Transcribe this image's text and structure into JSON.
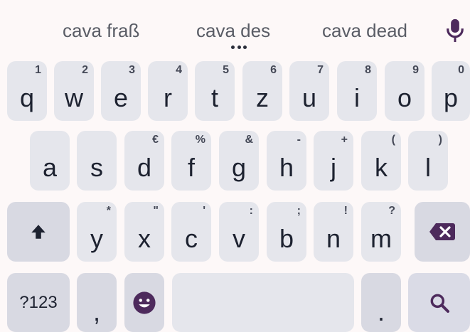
{
  "suggestions": [
    "cava fraß",
    "cava des",
    "cava dead"
  ],
  "icons": {
    "mic": "microphone-icon",
    "more": "more-dots-icon",
    "shift": "shift-arrow-icon",
    "backspace": "backspace-icon",
    "emoji": "emoji-icon",
    "search": "search-icon"
  },
  "colors": {
    "accent": "#4d2a5c",
    "key": "#e5e6ec",
    "text": "#1d2230"
  },
  "row1": [
    {
      "main": "q",
      "hint": "1"
    },
    {
      "main": "w",
      "hint": "2"
    },
    {
      "main": "e",
      "hint": "3"
    },
    {
      "main": "r",
      "hint": "4"
    },
    {
      "main": "t",
      "hint": "5"
    },
    {
      "main": "z",
      "hint": "6"
    },
    {
      "main": "u",
      "hint": "7"
    },
    {
      "main": "i",
      "hint": "8"
    },
    {
      "main": "o",
      "hint": "9"
    },
    {
      "main": "p",
      "hint": "0"
    }
  ],
  "row2": [
    {
      "main": "a",
      "hint": ""
    },
    {
      "main": "s",
      "hint": ""
    },
    {
      "main": "d",
      "hint": "€"
    },
    {
      "main": "f",
      "hint": "%"
    },
    {
      "main": "g",
      "hint": "&"
    },
    {
      "main": "h",
      "hint": "-"
    },
    {
      "main": "j",
      "hint": "+"
    },
    {
      "main": "k",
      "hint": "("
    },
    {
      "main": "l",
      "hint": ")"
    }
  ],
  "row3": [
    {
      "main": "y",
      "hint": "*"
    },
    {
      "main": "x",
      "hint": "\""
    },
    {
      "main": "c",
      "hint": "'"
    },
    {
      "main": "v",
      "hint": ":"
    },
    {
      "main": "b",
      "hint": ";"
    },
    {
      "main": "n",
      "hint": "!"
    },
    {
      "main": "m",
      "hint": "?"
    }
  ],
  "bottom": {
    "symbols": "?123",
    "comma": ",",
    "period": "."
  }
}
